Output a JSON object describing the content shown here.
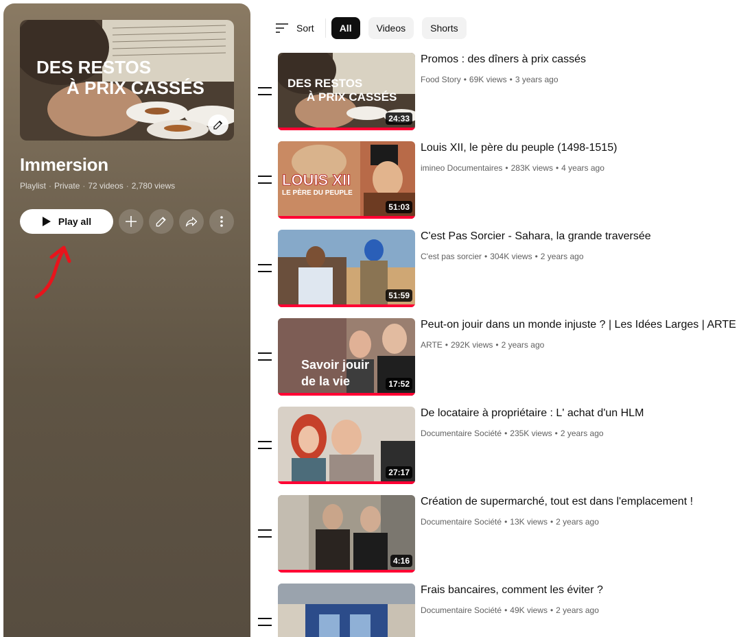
{
  "playlist": {
    "cover_text_line1": "DES RESTOS",
    "cover_text_line2": "À PRIX CASSÉS",
    "title": "Immersion",
    "type": "Playlist",
    "privacy": "Private",
    "video_count": "72 videos",
    "views": "2,780 views",
    "play_all_label": "Play all",
    "icons": [
      "add-icon",
      "edit-icon",
      "share-icon",
      "more-vert-icon"
    ]
  },
  "filters": {
    "sort_label": "Sort",
    "chips": [
      {
        "label": "All",
        "active": true
      },
      {
        "label": "Videos",
        "active": false
      },
      {
        "label": "Shorts",
        "active": false
      }
    ]
  },
  "videos": [
    {
      "title": "Promos : des dîners à prix cassés",
      "channel": "Food Story",
      "views": "69K views",
      "age": "3 years ago",
      "duration": "24:33",
      "overlay1": "DES RESTOS",
      "overlay2": "À PRIX CASSÉS",
      "watched": 1.0
    },
    {
      "title": "Louis XII, le père du peuple (1498-1515)",
      "channel": "imineo Documentaires",
      "views": "283K views",
      "age": "4 years ago",
      "duration": "51:03",
      "overlay1": "LOUIS XII",
      "overlay2": "LE PÈRE DU PEUPLE",
      "watched": 1.0
    },
    {
      "title": "C'est Pas Sorcier - Sahara, la grande traversée",
      "channel": "C'est pas sorcier",
      "views": "304K views",
      "age": "2 years ago",
      "duration": "51:59",
      "overlay1": "",
      "overlay2": "",
      "watched": 1.0
    },
    {
      "title": "Peut-on jouir dans un monde injuste ? | Les Idées Larges | ARTE",
      "channel": "ARTE",
      "views": "292K views",
      "age": "2 years ago",
      "duration": "17:52",
      "overlay1": "Savoir jouir",
      "overlay2": "de la vie",
      "watched": 1.0
    },
    {
      "title": "De locataire à propriétaire : L' achat d'un HLM",
      "channel": "Documentaire Société",
      "views": "235K views",
      "age": "2 years ago",
      "duration": "27:17",
      "overlay1": "",
      "overlay2": "",
      "watched": 1.0
    },
    {
      "title": "Création de supermarché, tout est dans l'emplacement !",
      "channel": "Documentaire Société",
      "views": "13K views",
      "age": "2 years ago",
      "duration": "4:16",
      "overlay1": "",
      "overlay2": "",
      "watched": 1.0
    },
    {
      "title": "Frais bancaires, comment les éviter ?",
      "channel": "Documentaire Société",
      "views": "49K views",
      "age": "2 years ago",
      "duration": "",
      "overlay1": "",
      "overlay2": "",
      "watched": 0
    }
  ],
  "colors": {
    "progress": "#ff0033",
    "annotation_arrow": "#e8141c",
    "panel": "#5f5444"
  }
}
